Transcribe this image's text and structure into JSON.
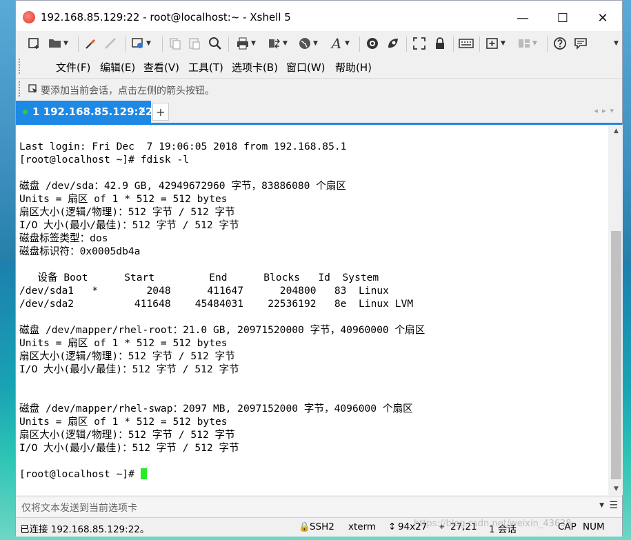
{
  "window": {
    "title": "192.168.85.129:22 - root@localhost:~ - Xshell 5",
    "minimize": "—",
    "maximize": "☐",
    "close": "✕"
  },
  "toolbar": {
    "icons": [
      "new-session-icon",
      "open-folder-icon",
      "connect-icon",
      "disconnect-icon",
      "properties-icon",
      "copy-icon",
      "paste-icon",
      "find-icon",
      "print-icon",
      "transfer-icon",
      "globe-icon",
      "font-icon",
      "xftp-icon",
      "xagent-icon",
      "fullscreen-icon",
      "lock-icon",
      "keyboard-icon",
      "new-tab-icon",
      "layout-icon",
      "help-icon",
      "chat-icon"
    ]
  },
  "menu": {
    "items": [
      "文件(F)",
      "编辑(E)",
      "查看(V)",
      "工具(T)",
      "选项卡(B)",
      "窗口(W)",
      "帮助(H)"
    ]
  },
  "hint": {
    "text": "要添加当前会话，点击左侧的箭头按钮。"
  },
  "tabs": [
    {
      "label": "1 192.168.85.129:22",
      "active": true,
      "status_color": "#2ecc40"
    }
  ],
  "terminal": {
    "lines": [
      "Last login: Fri Dec  7 19:06:05 2018 from 192.168.85.1",
      "[root@localhost ~]# fdisk -l",
      "",
      "磁盘 /dev/sda：42.9 GB, 42949672960 字节，83886080 个扇区",
      "Units = 扇区 of 1 * 512 = 512 bytes",
      "扇区大小(逻辑/物理)：512 字节 / 512 字节",
      "I/O 大小(最小/最佳)：512 字节 / 512 字节",
      "磁盘标签类型：dos",
      "磁盘标识符：0x0005db4a",
      "",
      "   设备 Boot      Start         End      Blocks   Id  System",
      "/dev/sda1   *        2048      411647      204800   83  Linux",
      "/dev/sda2          411648    45484031    22536192   8e  Linux LVM",
      "",
      "磁盘 /dev/mapper/rhel-root：21.0 GB, 20971520000 字节，40960000 个扇区",
      "Units = 扇区 of 1 * 512 = 512 bytes",
      "扇区大小(逻辑/物理)：512 字节 / 512 字节",
      "I/O 大小(最小/最佳)：512 字节 / 512 字节",
      "",
      "",
      "磁盘 /dev/mapper/rhel-swap：2097 MB, 2097152000 字节，4096000 个扇区",
      "Units = 扇区 of 1 * 512 = 512 bytes",
      "扇区大小(逻辑/物理)：512 字节 / 512 字节",
      "I/O 大小(最小/最佳)：512 字节 / 512 字节",
      "",
      "[root@localhost ~]# "
    ],
    "cursor_color": "#22ee22"
  },
  "sendbar": {
    "placeholder": "仅将文本发送到当前选项卡"
  },
  "status": {
    "connection": "已连接 192.168.85.129:22。",
    "protocol": "SSH2",
    "terminal_type": "xterm",
    "size": "94x27",
    "position": "27,21",
    "sessions": "1 会话",
    "caps": "CAP",
    "num": "NUM"
  },
  "watermark": "https://blog.csdn.net/weixin_43638"
}
